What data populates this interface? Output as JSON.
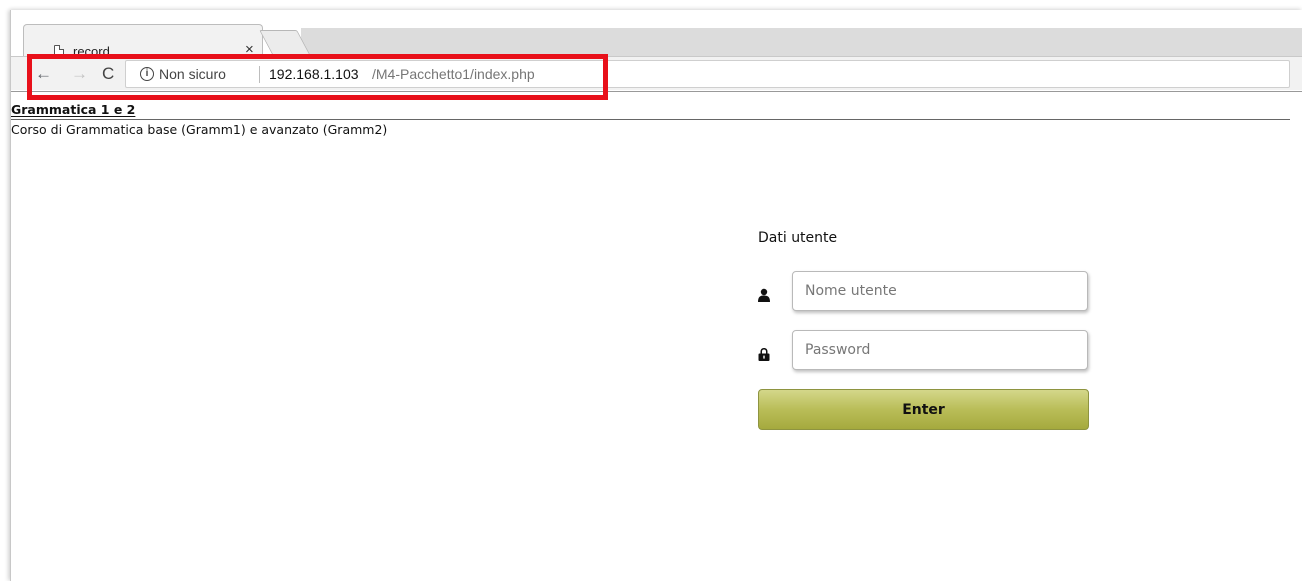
{
  "browser": {
    "tab": {
      "title": "record",
      "close_glyph": "×"
    },
    "nav": {
      "back_glyph": "←",
      "forward_glyph": "→",
      "reload_glyph": "C"
    },
    "omnibox": {
      "info_glyph": "i",
      "security_label": "Non sicuro",
      "url_host": "192.168.1.103",
      "url_path": "/M4-Pacchetto1/index.php"
    },
    "highlight_color": "#e8101a"
  },
  "page": {
    "title": "Grammatica 1 e 2",
    "subtitle": "Corso di Grammatica base (Gramm1) e avanzato (Gramm2)"
  },
  "login": {
    "heading": "Dati utente",
    "username_placeholder": "Nome utente",
    "password_placeholder": "Password",
    "submit_label": "Enter",
    "button_color": "#b9bd58",
    "icons": {
      "username": "user-icon",
      "password": "lock-icon"
    }
  }
}
